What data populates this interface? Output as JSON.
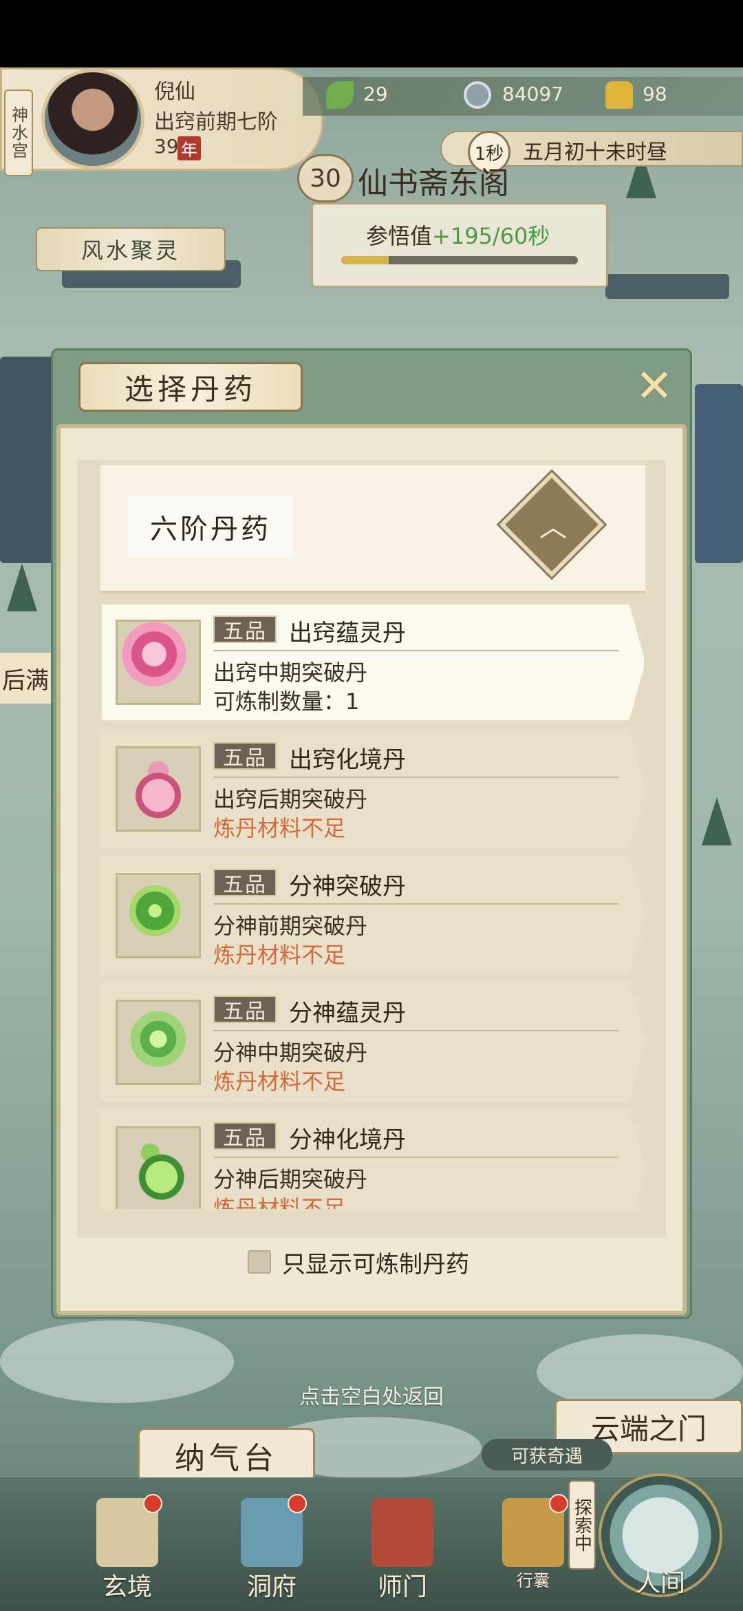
{
  "player": {
    "sect": "神水宫",
    "name": "倪仙",
    "realm": "出窍前期七阶",
    "age": "39",
    "age_unit": "年"
  },
  "resources": [
    {
      "icon": "jade-leaf-icon",
      "value": "29",
      "color": "#6fae4a"
    },
    {
      "icon": "coin-icon",
      "value": "84097",
      "color": "#8fa0a6"
    },
    {
      "icon": "gold-ingot-icon",
      "value": "98",
      "color": "#e0b63a"
    }
  ],
  "time": {
    "speed": "1秒",
    "text": "五月初十未时昼"
  },
  "study": {
    "level": "30",
    "title": "仙书斋东阁",
    "label": "参悟值",
    "value": "+195/60秒",
    "progress": 0.2
  },
  "fengshui_label": "风水聚灵",
  "left_edge_text": "后满",
  "dialog": {
    "title": "选择丹药",
    "category": "六阶丹药",
    "pills": [
      {
        "grade": "五品",
        "name": "出窍蕴灵丹",
        "desc": "出窍中期突破丹",
        "status": "可炼制数量：1",
        "warn": false,
        "icon": "pink-lotus-pill-icon"
      },
      {
        "grade": "五品",
        "name": "出窍化境丹",
        "desc": "出窍后期突破丹",
        "status": "炼丹材料不足",
        "warn": true,
        "icon": "pink-gourd-pill-icon"
      },
      {
        "grade": "五品",
        "name": "分神突破丹",
        "desc": "分神前期突破丹",
        "status": "炼丹材料不足",
        "warn": true,
        "icon": "green-orb-pill-icon"
      },
      {
        "grade": "五品",
        "name": "分神蕴灵丹",
        "desc": "分神中期突破丹",
        "status": "炼丹材料不足",
        "warn": true,
        "icon": "green-lotus-pill-icon"
      },
      {
        "grade": "五品",
        "name": "分神化境丹",
        "desc": "分神后期突破丹",
        "status": "炼丹材料不足",
        "warn": true,
        "icon": "green-gourd-pill-icon"
      }
    ],
    "filter_label": "只显示可炼制丹药",
    "filter_checked": false
  },
  "hint": "点击空白处返回",
  "cloud_gate": "云端之门",
  "reward_badge": "可获奇遇",
  "nqt": "纳气台",
  "explore": "探索中",
  "nav": [
    {
      "label": "玄境",
      "icon": "scroll-icon",
      "dot": true
    },
    {
      "label": "洞府",
      "icon": "lantern-icon",
      "dot": true
    },
    {
      "label": "师门",
      "icon": "banner-icon",
      "dot": false
    },
    {
      "label": "行囊",
      "icon": "bag-icon",
      "dot": true
    },
    {
      "label": "人间",
      "icon": "portal-icon",
      "dot": false
    }
  ]
}
